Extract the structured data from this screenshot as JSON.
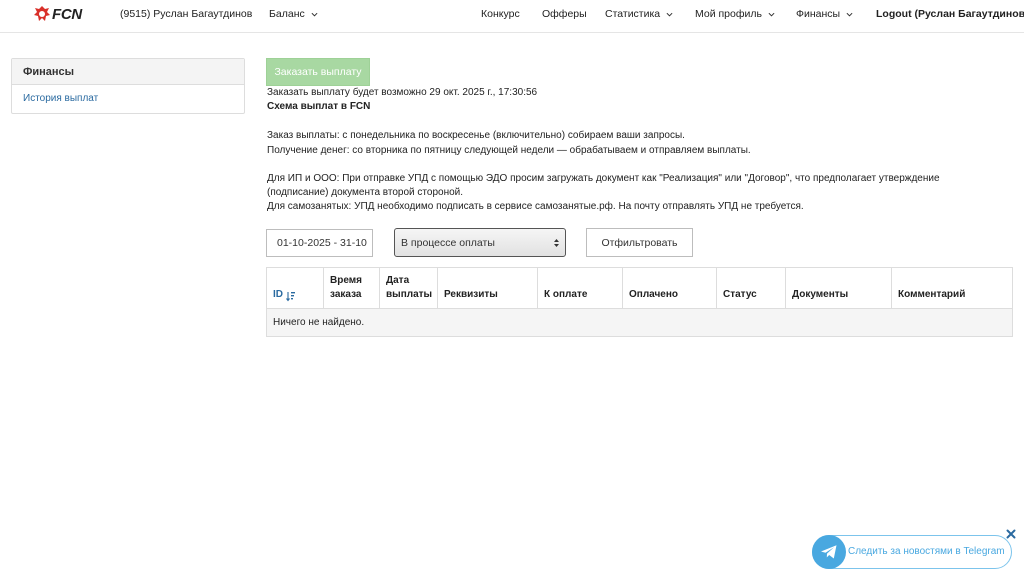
{
  "nav": {
    "logo_text": "FCN",
    "user": "(9515) Руслан Багаутдинов",
    "balance": "Баланс",
    "contest": "Конкурс",
    "offers": "Офферы",
    "statistics": "Статистика",
    "profile": "Мой профиль",
    "finance": "Финансы",
    "logout": "Logout (Руслан Багаутдинов)"
  },
  "sidebar": {
    "title": "Финансы",
    "items": [
      {
        "label": "История выплат"
      }
    ]
  },
  "main": {
    "order_button": "Заказать выплату",
    "order_available": "Заказать выплату будет возможно 29 окт. 2025 г., 17:30:56",
    "scheme_title": "Схема выплат в FCN",
    "line_order": "Заказ выплаты: с понедельника по воскресенье (включительно) собираем ваши запросы.",
    "line_receive": "Получение денег: со вторника по пятницу следующей недели — обрабатываем и отправляем выплаты.",
    "line_ip_1": "Для ИП и ООО: При отправке УПД с помощью ЭДО просим загружать документ как \"Реализация\" или \"Договор\", что предполагает утверждение",
    "line_ip_2": "(подписание) документа второй стороной.",
    "line_self": "Для самозанятых: УПД необходимо подписать в сервисе самозанятые.рф. На почту отправлять УПД не требуется."
  },
  "filters": {
    "date_range": "01-10-2025 - 31-10",
    "status_selected": "В процессе оплаты",
    "filter_button": "Отфильтровать"
  },
  "table": {
    "columns": [
      {
        "line1": "ID",
        "line2": ""
      },
      {
        "line1": "Время",
        "line2": "заказа"
      },
      {
        "line1": "Дата",
        "line2": "выплаты"
      },
      {
        "line1": "Реквизиты",
        "line2": ""
      },
      {
        "line1": "К оплате",
        "line2": ""
      },
      {
        "line1": "Оплачено",
        "line2": ""
      },
      {
        "line1": "Статус",
        "line2": ""
      },
      {
        "line1": "Документы",
        "line2": ""
      },
      {
        "line1": "Комментарий",
        "line2": ""
      }
    ],
    "empty_text": "Ничего не найдено."
  },
  "telegram": {
    "text": "Следить за новостями в Telegram"
  },
  "colors": {
    "accent_link": "#2a6aa0",
    "order_button_bg": "#a8d8a2",
    "telegram_blue": "#49a8e0",
    "logo_red": "#d9302a"
  },
  "icons": [
    "fcn-logo-icon",
    "chevron-down-icon",
    "sort-icon",
    "select-arrows-icon",
    "telegram-icon",
    "close-icon"
  ]
}
